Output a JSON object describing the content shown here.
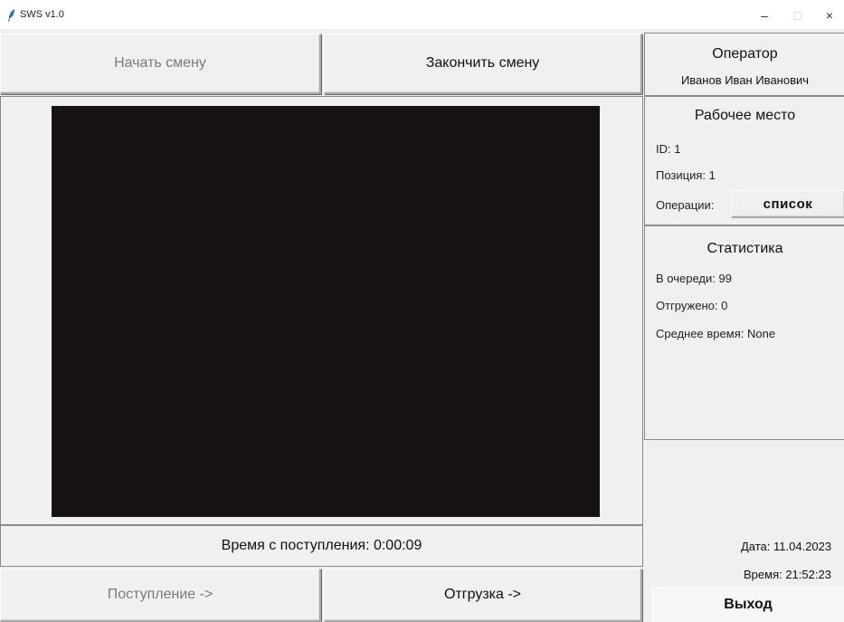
{
  "window": {
    "title": "SWS v1.0",
    "controls": {
      "minimize": "–",
      "maximize": "□",
      "close": "×"
    }
  },
  "toolbar": {
    "start_shift": "Начать смену",
    "end_shift": "Закончить смену"
  },
  "operator": {
    "title": "Оператор",
    "name": "Иванов Иван Иванович"
  },
  "workplace": {
    "title": "Рабочее место",
    "id": "ID: 1",
    "position": "Позиция: 1",
    "operations_label": "Операции:",
    "operations_button": "список"
  },
  "stats": {
    "title": "Статистика",
    "in_queue": "В очереди: 99",
    "shipped": "Отгружено: 0",
    "avg_time": "Среднее время: None"
  },
  "status": {
    "time_since_arrival": "Время с поступления: 0:00:09",
    "date": "Дата: 11.04.2023",
    "time": "Время: 21:52:23"
  },
  "actions": {
    "arrival": "Поступление ->",
    "shipment": "Отгрузка ->",
    "exit": "Выход"
  },
  "colors": {
    "background": "#f0f0f0",
    "video_feed": "#171313",
    "disabled_text": "#7a7a7a"
  }
}
